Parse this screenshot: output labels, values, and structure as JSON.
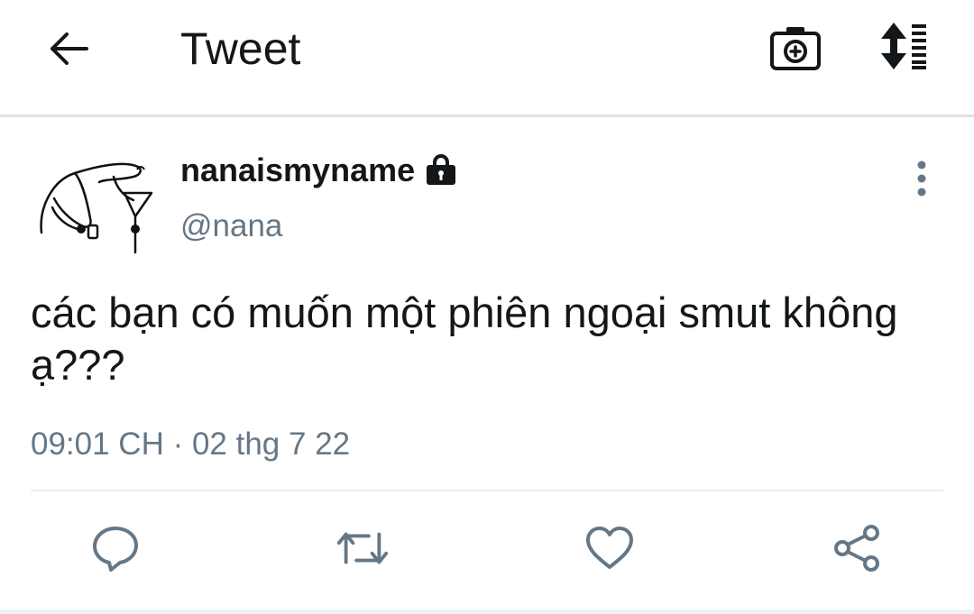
{
  "header": {
    "title": "Tweet",
    "back_icon": "arrow-left-icon",
    "camera_icon": "camera-plus-icon",
    "sort_icon": "sort-list-icon"
  },
  "tweet": {
    "author": {
      "display_name": "nanaismyname",
      "handle": "@nana",
      "protected_icon": "lock-icon",
      "avatar": "hand-drawn-doodle-avatar"
    },
    "text": "các bạn có muốn một phiên ngoại smut không ạ???",
    "timestamp": "09:01 CH · 02 thg 7 22",
    "more_icon": "more-vertical-icon"
  },
  "actions": [
    {
      "name": "reply",
      "icon": "comment-icon"
    },
    {
      "name": "retweet",
      "icon": "retweet-icon"
    },
    {
      "name": "like",
      "icon": "heart-icon"
    },
    {
      "name": "share",
      "icon": "share-icon"
    }
  ],
  "colors": {
    "text_primary": "#14171a",
    "text_secondary": "#657786",
    "icon": "#657786",
    "divider": "#e6ecf0"
  }
}
